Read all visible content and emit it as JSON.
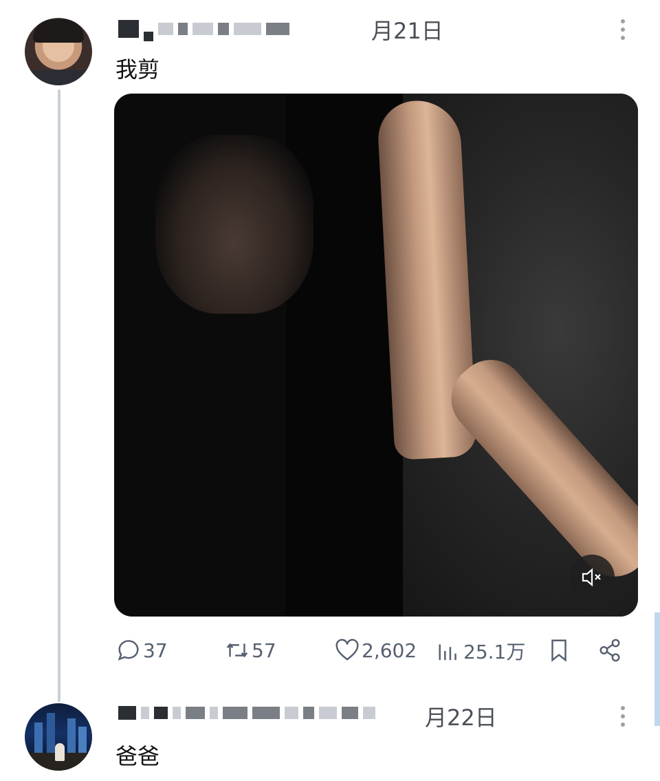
{
  "posts": [
    {
      "date_text": "月21日",
      "text": "我剪",
      "stats": {
        "replies": "37",
        "reposts": "57",
        "likes": "2,602",
        "views": "25.1万"
      }
    },
    {
      "date_text": "月22日",
      "text": "爸爸"
    }
  ],
  "icons": {
    "reply": "speech-bubble-icon",
    "repost": "repost-arrows-icon",
    "like": "heart-icon",
    "views": "bar-chart-icon",
    "bookmark": "bookmark-icon",
    "share": "share-icon",
    "mute": "speaker-muted-icon",
    "more": "vertical-dots-icon"
  },
  "colors": {
    "icon_gray": "#566070",
    "thread_line": "#c9cfd6",
    "scroll_thumb": "#bfd8ee"
  }
}
